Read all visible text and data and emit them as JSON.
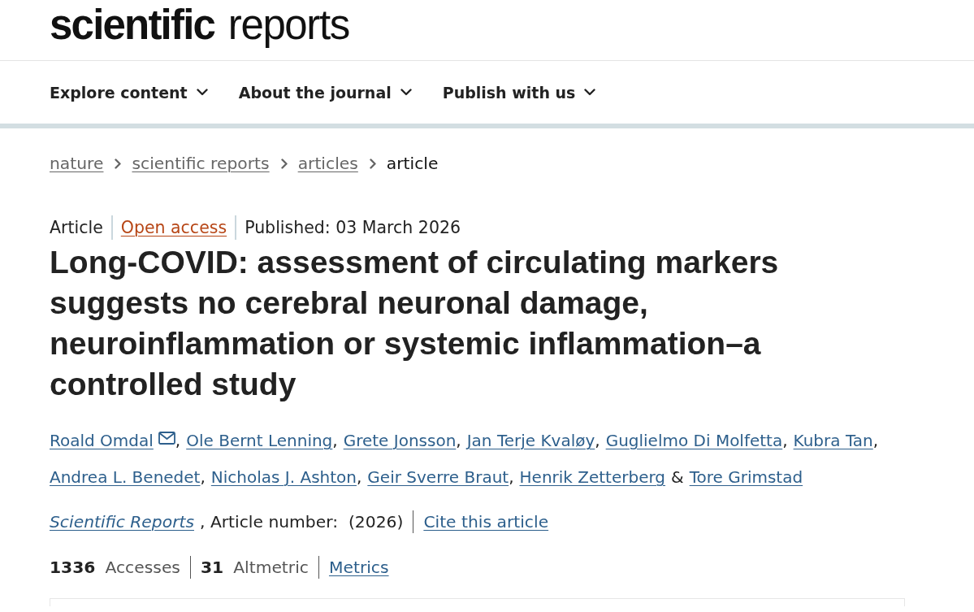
{
  "header": {
    "logo": "**scientific** reports"
  },
  "nav": {
    "items": [
      {
        "label": "Explore content"
      },
      {
        "label": "About the journal"
      },
      {
        "label": "Publish with us"
      }
    ]
  },
  "breadcrumb": [
    {
      "label": "nature",
      "current": false
    },
    {
      "label": "scientific reports",
      "current": false
    },
    {
      "label": "articles",
      "current": false
    },
    {
      "label": "article",
      "current": true
    }
  ],
  "article_meta": {
    "type": "Article",
    "access": "Open access",
    "published": "Published: 03 March 2026"
  },
  "title": "Long-COVID: assessment of circulating markers suggests no cerebral neuronal damage, neuroinflammation or systemic inflammation–a controlled study",
  "authors": [
    {
      "name": "Roald Omdal",
      "corresponding": true,
      "separator": ","
    },
    {
      "name": "Ole Bernt Lenning",
      "corresponding": false,
      "separator": ","
    },
    {
      "name": "Grete Jonsson",
      "corresponding": false,
      "separator": ","
    },
    {
      "name": "Jan Terje Kvaløy",
      "corresponding": false,
      "separator": ","
    },
    {
      "name": "Guglielmo Di Molfetta",
      "corresponding": false,
      "separator": ","
    },
    {
      "name": "Kubra Tan",
      "corresponding": false,
      "separator": ","
    },
    {
      "name": "Andrea L. Benedet",
      "corresponding": false,
      "separator": ","
    },
    {
      "name": "Nicholas J. Ashton",
      "corresponding": false,
      "separator": ","
    },
    {
      "name": "Geir Sverre Braut",
      "corresponding": false,
      "separator": ","
    },
    {
      "name": "Henrik Zetterberg",
      "corresponding": false
    },
    {
      "name": "Tore Grimstad",
      "corresponding": false,
      "conjunction": "&"
    }
  ],
  "citation": {
    "journal": "Scientific Reports",
    "details": ", Article number:  (2026)",
    "cite_link": "Cite this article"
  },
  "metrics": {
    "items": [
      {
        "count": "1336",
        "label": "Accesses"
      },
      {
        "count": "31",
        "label": "Altmetric"
      }
    ],
    "link": "Metrics"
  }
}
